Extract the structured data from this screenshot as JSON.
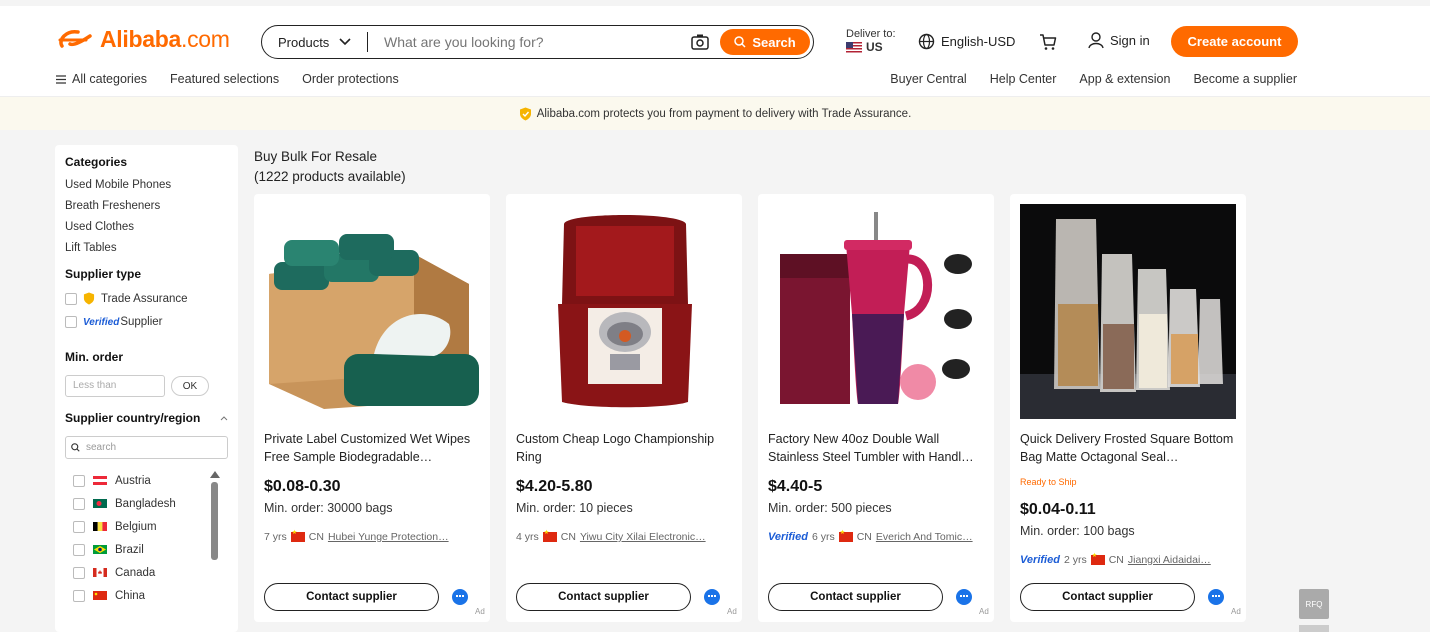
{
  "header": {
    "logo_brand": "Alibaba",
    "logo_tld": ".com",
    "search_category": "Products",
    "search_placeholder": "What are you looking for?",
    "search_button": "Search",
    "deliver_label": "Deliver to:",
    "deliver_country": "US",
    "language": "English-USD",
    "signin": "Sign in",
    "create_account": "Create account"
  },
  "subnav": {
    "left": [
      "All categories",
      "Featured selections",
      "Order protections"
    ],
    "right": [
      "Buyer Central",
      "Help Center",
      "App & extension",
      "Become a supplier"
    ]
  },
  "banner": {
    "text": "Alibaba.com protects you from payment to delivery with Trade Assurance."
  },
  "sidebar": {
    "categories_title": "Categories",
    "categories": [
      "Used Mobile Phones",
      "Breath Fresheners",
      "Used Clothes",
      "Lift Tables"
    ],
    "supplier_type_title": "Supplier type",
    "supplier_types": [
      "Trade Assurance",
      "Supplier"
    ],
    "verified_mark": "Verified",
    "min_order_title": "Min. order",
    "min_order_placeholder": "Less than",
    "ok_button": "OK",
    "region_title": "Supplier country/region",
    "region_search_placeholder": "search",
    "countries": [
      {
        "name": "Austria",
        "flag": "austria"
      },
      {
        "name": "Bangladesh",
        "flag": "bangladesh"
      },
      {
        "name": "Belgium",
        "flag": "belgium"
      },
      {
        "name": "Brazil",
        "flag": "brazil"
      },
      {
        "name": "Canada",
        "flag": "canada"
      },
      {
        "name": "China",
        "flag": "china"
      }
    ]
  },
  "main": {
    "heading": "Buy Bulk For Resale",
    "count": "(1222 products available)"
  },
  "products": [
    {
      "title": "Private Label Customized Wet Wipes Free Sample Biodegradable…",
      "ready": "",
      "price": "$0.08-0.30",
      "moq": "Min. order: 30000 bags",
      "verified": "",
      "years": "7 yrs",
      "country": "CN",
      "supplier": "Hubei Yunge Protection…",
      "contact": "Contact supplier",
      "ad": "Ad"
    },
    {
      "title": "Custom Cheap Logo Championship Ring",
      "ready": "",
      "price": "$4.20-5.80",
      "moq": "Min. order: 10 pieces",
      "verified": "",
      "years": "4 yrs",
      "country": "CN",
      "supplier": "Yiwu City Xilai Electronic…",
      "contact": "Contact supplier",
      "ad": "Ad"
    },
    {
      "title": "Factory New 40oz Double Wall Stainless Steel Tumbler with Handl…",
      "ready": "",
      "price": "$4.40-5",
      "moq": "Min. order: 500 pieces",
      "verified": "Verified",
      "years": "6 yrs",
      "country": "CN",
      "supplier": "Everich And Tomic…",
      "contact": "Contact supplier",
      "ad": "Ad"
    },
    {
      "title": "Quick Delivery Frosted Square Bottom Bag Matte Octagonal Seal…",
      "ready": "Ready to Ship",
      "price": "$0.04-0.11",
      "moq": "Min. order: 100 bags",
      "verified": "Verified",
      "years": "2 yrs",
      "country": "CN",
      "supplier": "Jiangxi Aidaidai…",
      "contact": "Contact supplier",
      "ad": "Ad"
    }
  ],
  "float": {
    "rfq": "RFQ"
  },
  "colors": {
    "brand": "#ff6a00",
    "verified": "#1b5cd6",
    "chat": "#1a73e8"
  }
}
